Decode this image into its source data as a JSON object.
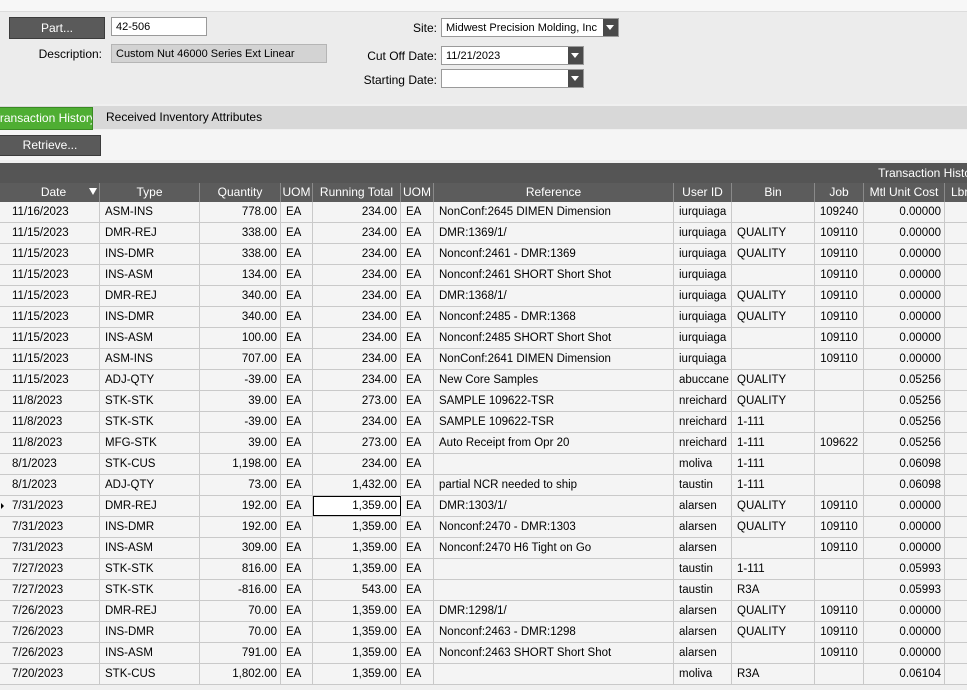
{
  "header": {
    "part_button": "Part...",
    "part_value": "42-506",
    "description_label": "Description:",
    "description_value": "Custom Nut 46000 Series Ext Linear",
    "site_label": "Site:",
    "site_value": "Midwest Precision Molding, Inc",
    "cutoff_label": "Cut Off Date:",
    "cutoff_value": "11/21/2023",
    "starting_label": "Starting Date:",
    "starting_value": ""
  },
  "tabs": [
    {
      "label": "Transaction History",
      "active": true
    },
    {
      "label": "Received Inventory Attributes",
      "active": false
    }
  ],
  "toolbar": {
    "retrieve_label": "Retrieve..."
  },
  "grid": {
    "title": "Transaction History",
    "columns": [
      "Date",
      "Type",
      "Quantity",
      "UOM",
      "Running Total",
      "UOM",
      "Reference",
      "User ID",
      "Bin",
      "Job",
      "Mtl Unit Cost",
      "Lbr"
    ],
    "rows": [
      [
        "11/16/2023",
        "ASM-INS",
        "778.00",
        "EA",
        "234.00",
        "EA",
        "NonConf:2645 DIMEN Dimension",
        "iurquiaga",
        "",
        "109240",
        "0.00000"
      ],
      [
        "11/15/2023",
        "DMR-REJ",
        "338.00",
        "EA",
        "234.00",
        "EA",
        "DMR:1369/1/",
        "iurquiaga",
        "QUALITY",
        "109110",
        "0.00000"
      ],
      [
        "11/15/2023",
        "INS-DMR",
        "338.00",
        "EA",
        "234.00",
        "EA",
        "Nonconf:2461 - DMR:1369",
        "iurquiaga",
        "QUALITY",
        "109110",
        "0.00000"
      ],
      [
        "11/15/2023",
        "INS-ASM",
        "134.00",
        "EA",
        "234.00",
        "EA",
        "Nonconf:2461 SHORT Short Shot",
        "iurquiaga",
        "",
        "109110",
        "0.00000"
      ],
      [
        "11/15/2023",
        "DMR-REJ",
        "340.00",
        "EA",
        "234.00",
        "EA",
        "DMR:1368/1/",
        "iurquiaga",
        "QUALITY",
        "109110",
        "0.00000"
      ],
      [
        "11/15/2023",
        "INS-DMR",
        "340.00",
        "EA",
        "234.00",
        "EA",
        "Nonconf:2485 - DMR:1368",
        "iurquiaga",
        "QUALITY",
        "109110",
        "0.00000"
      ],
      [
        "11/15/2023",
        "INS-ASM",
        "100.00",
        "EA",
        "234.00",
        "EA",
        "Nonconf:2485 SHORT Short Shot",
        "iurquiaga",
        "",
        "109110",
        "0.00000"
      ],
      [
        "11/15/2023",
        "ASM-INS",
        "707.00",
        "EA",
        "234.00",
        "EA",
        "NonConf:2641 DIMEN Dimension",
        "iurquiaga",
        "",
        "109110",
        "0.00000"
      ],
      [
        "11/15/2023",
        "ADJ-QTY",
        "-39.00",
        "EA",
        "234.00",
        "EA",
        "New Core Samples",
        "abuccane",
        "QUALITY",
        "",
        "0.05256"
      ],
      [
        "11/8/2023",
        "STK-STK",
        "39.00",
        "EA",
        "273.00",
        "EA",
        "SAMPLE 109622-TSR",
        "nreichard",
        "QUALITY",
        "",
        "0.05256"
      ],
      [
        "11/8/2023",
        "STK-STK",
        "-39.00",
        "EA",
        "234.00",
        "EA",
        "SAMPLE 109622-TSR",
        "nreichard",
        "1-111",
        "",
        "0.05256"
      ],
      [
        "11/8/2023",
        "MFG-STK",
        "39.00",
        "EA",
        "273.00",
        "EA",
        "Auto Receipt from Opr 20",
        "nreichard",
        "1-111",
        "109622",
        "0.05256"
      ],
      [
        "8/1/2023",
        "STK-CUS",
        "1,198.00",
        "EA",
        "234.00",
        "EA",
        "",
        "moliva",
        "1-111",
        "",
        "0.06098"
      ],
      [
        "8/1/2023",
        "ADJ-QTY",
        "73.00",
        "EA",
        "1,432.00",
        "EA",
        "partial NCR needed to ship",
        "taustin",
        "1-111",
        "",
        "0.06098"
      ],
      [
        "7/31/2023",
        "DMR-REJ",
        "192.00",
        "EA",
        "1,359.00",
        "EA",
        "DMR:1303/1/",
        "alarsen",
        "QUALITY",
        "109110",
        "0.00000"
      ],
      [
        "7/31/2023",
        "INS-DMR",
        "192.00",
        "EA",
        "1,359.00",
        "EA",
        "Nonconf:2470 - DMR:1303",
        "alarsen",
        "QUALITY",
        "109110",
        "0.00000"
      ],
      [
        "7/31/2023",
        "INS-ASM",
        "309.00",
        "EA",
        "1,359.00",
        "EA",
        "Nonconf:2470 H6 Tight on Go",
        "alarsen",
        "",
        "109110",
        "0.00000"
      ],
      [
        "7/27/2023",
        "STK-STK",
        "816.00",
        "EA",
        "1,359.00",
        "EA",
        "",
        "taustin",
        "1-111",
        "",
        "0.05993"
      ],
      [
        "7/27/2023",
        "STK-STK",
        "-816.00",
        "EA",
        "543.00",
        "EA",
        "",
        "taustin",
        "R3A",
        "",
        "0.05993"
      ],
      [
        "7/26/2023",
        "DMR-REJ",
        "70.00",
        "EA",
        "1,359.00",
        "EA",
        "DMR:1298/1/",
        "alarsen",
        "QUALITY",
        "109110",
        "0.00000"
      ],
      [
        "7/26/2023",
        "INS-DMR",
        "70.00",
        "EA",
        "1,359.00",
        "EA",
        "Nonconf:2463 - DMR:1298",
        "alarsen",
        "QUALITY",
        "109110",
        "0.00000"
      ],
      [
        "7/26/2023",
        "INS-ASM",
        "791.00",
        "EA",
        "1,359.00",
        "EA",
        "Nonconf:2463 SHORT Short Shot",
        "alarsen",
        "",
        "109110",
        "0.00000"
      ],
      [
        "7/20/2023",
        "STK-CUS",
        "1,802.00",
        "EA",
        "1,359.00",
        "EA",
        "",
        "moliva",
        "R3A",
        "",
        "0.06104"
      ]
    ],
    "selected_row": 14,
    "selected_col": 4
  }
}
